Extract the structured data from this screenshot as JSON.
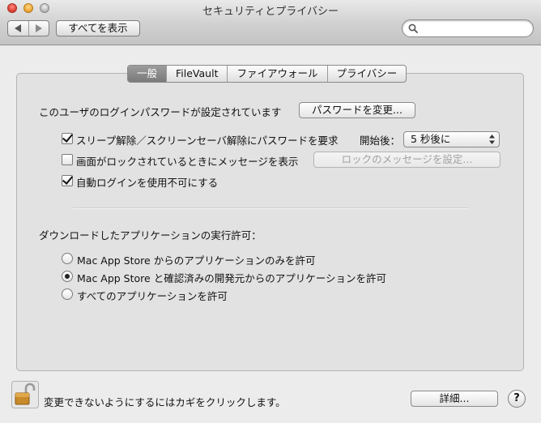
{
  "window": {
    "title": "セキュリティとプライバシー"
  },
  "toolbar": {
    "show_all_label": "すべてを表示",
    "search_placeholder": ""
  },
  "tabs": [
    {
      "label": "一般",
      "active": true
    },
    {
      "label": "FileVault",
      "active": false
    },
    {
      "label": "ファイアウォール",
      "active": false
    },
    {
      "label": "プライバシー",
      "active": false
    }
  ],
  "general": {
    "password_set_text": "このユーザのログインパスワードが設定されています",
    "change_password_label": "パスワードを変更...",
    "require_password": {
      "label": "スリープ解除／スクリーンセーバ解除にパスワードを要求",
      "checked": true
    },
    "start_after_label": "開始後：",
    "start_after_value": "5 秒後に",
    "show_message": {
      "label": "画面がロックされているときにメッセージを表示",
      "checked": false
    },
    "set_lock_message_label": "ロックのメッセージを設定...",
    "disable_auto_login": {
      "label": "自動ログインを使用不可にする",
      "checked": true
    },
    "allow_apps_heading": "ダウンロードしたアプリケーションの実行許可：",
    "allow_options": [
      {
        "label": "Mac App Store からのアプリケーションのみを許可",
        "selected": false
      },
      {
        "label": "Mac App Store と確認済みの開発元からのアプリケーションを許可",
        "selected": true
      },
      {
        "label": "すべてのアプリケーションを許可",
        "selected": false
      }
    ]
  },
  "footer": {
    "lock_text": "変更できないようにするにはカギをクリックします。",
    "advanced_label": "詳細...",
    "help_label": "?"
  },
  "colors": {
    "active_tab": "#8a8a8a",
    "window_bg": "#ececec",
    "panel_bg": "#e2e2e2"
  }
}
